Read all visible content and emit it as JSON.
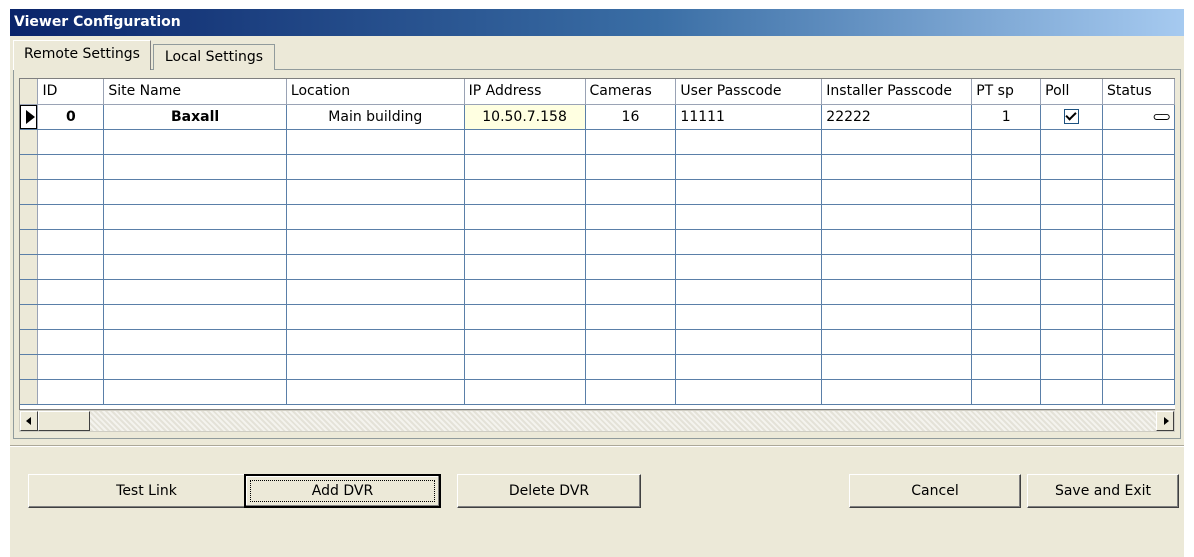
{
  "window": {
    "title": "Viewer Configuration"
  },
  "tabs": [
    {
      "label": "Remote Settings",
      "active": true
    },
    {
      "label": "Local Settings",
      "active": false
    }
  ],
  "grid": {
    "columns": [
      "ID",
      "Site Name",
      "Location",
      "IP Address",
      "Cameras",
      "User Passcode",
      "Installer Passcode",
      "PT sp",
      "Poll",
      "Status"
    ],
    "rows": [
      {
        "id": "0",
        "site_name": "Baxall",
        "location": "Main building",
        "ip_address": "10.50.7.158",
        "cameras": "16",
        "user_passcode": "11111",
        "installer_passcode": "22222",
        "pt_sp": "1",
        "poll": true,
        "status_icon": "link-icon"
      }
    ],
    "empty_rows": 11
  },
  "buttons": {
    "test_link": "Test Link",
    "add_dvr": "Add DVR",
    "delete_dvr": "Delete DVR",
    "cancel": "Cancel",
    "save_exit": "Save and Exit"
  },
  "colors": {
    "title_bar": "#0a246a",
    "window_bg": "#ece9d8",
    "grid_line": "#5a7fa8",
    "ip_cell_bg": "#ffffe1"
  }
}
